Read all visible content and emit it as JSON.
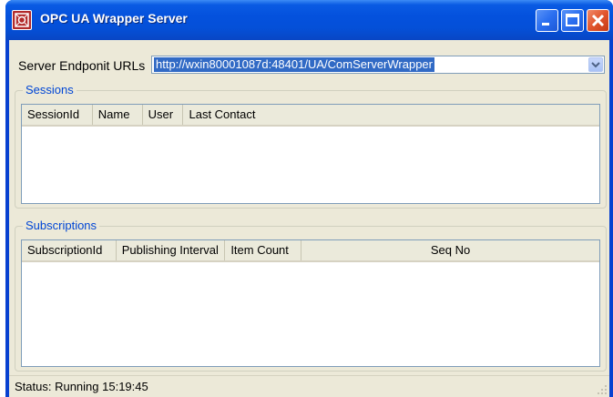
{
  "window": {
    "title": "OPC UA Wrapper Server"
  },
  "endpoint": {
    "label": "Server Endponit URLs",
    "value": "http://wxin80001087d:48401/UA/ComServerWrapper"
  },
  "sessions": {
    "title": "Sessions",
    "columns": [
      "SessionId",
      "Name",
      "User",
      "Last Contact"
    ]
  },
  "subscriptions": {
    "title": "Subscriptions",
    "columns": [
      "SubscriptionId",
      "Publishing Interval",
      "Item Count",
      "Seq No"
    ]
  },
  "status": {
    "text": "Status: Running 15:19:45"
  },
  "colors": {
    "title_bar": "#0451dd",
    "client_bg": "#ece9d8",
    "selection": "#316ac5",
    "group_title": "#0046d5"
  },
  "icons": [
    "app-icon",
    "minimize-icon",
    "maximize-icon",
    "close-icon",
    "chevron-down-icon",
    "resize-grip-icon"
  ]
}
